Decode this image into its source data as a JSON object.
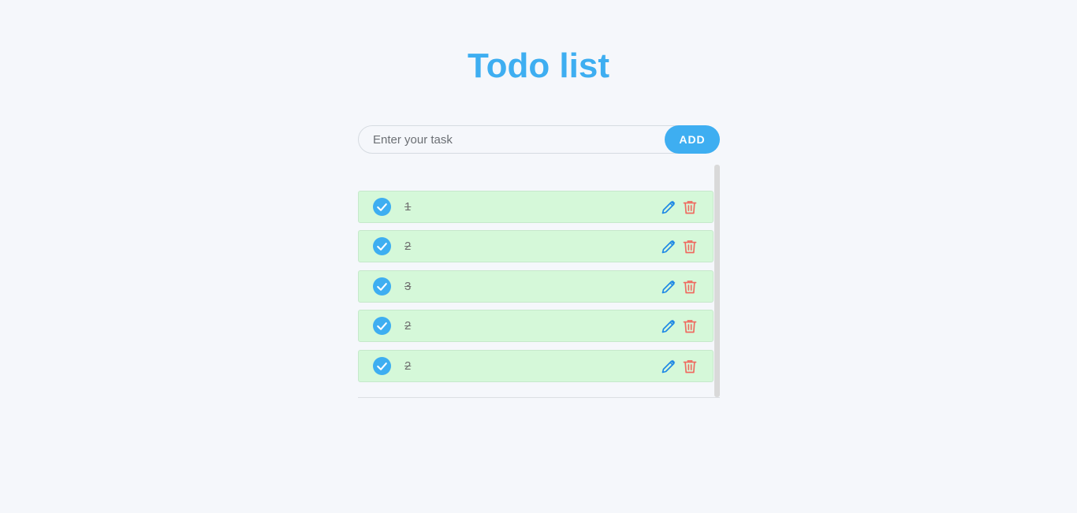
{
  "title": "Todo list",
  "input": {
    "placeholder": "Enter your task",
    "value": ""
  },
  "add_button": {
    "label": "ADD"
  },
  "tasks": [
    {
      "text": "1",
      "completed": true
    },
    {
      "text": "2",
      "completed": true
    },
    {
      "text": "3",
      "completed": true
    },
    {
      "text": "2",
      "completed": true
    },
    {
      "text": "2",
      "completed": true
    }
  ],
  "icons": {
    "check": "check-circle-icon",
    "edit": "pencil-icon",
    "delete": "trash-icon"
  },
  "colors": {
    "accent": "#3eaef1",
    "completed_bg": "#d5f8d9",
    "edit": "#1e88e5",
    "delete": "#ef6b60"
  }
}
